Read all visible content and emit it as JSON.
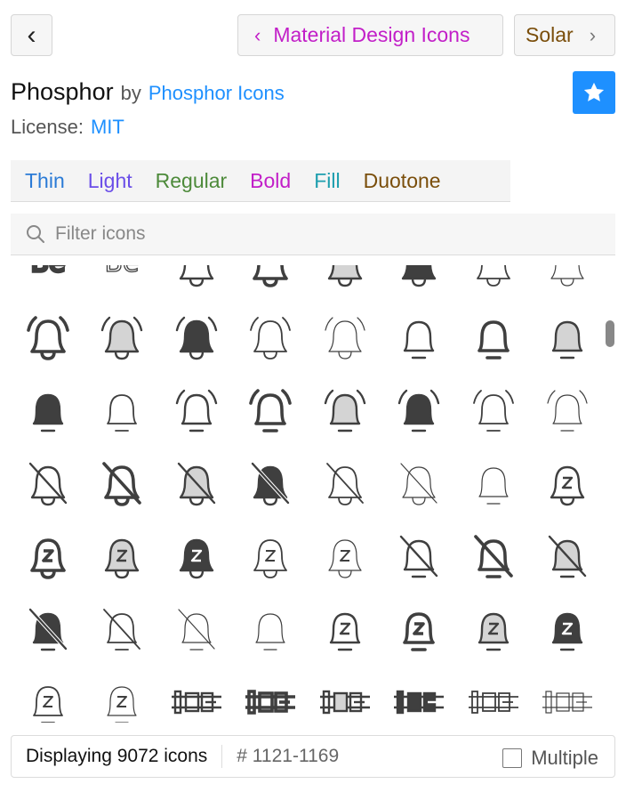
{
  "nav": {
    "back_label": "‹",
    "prev_label": "Material Design Icons",
    "prev_color": "#c21fc8",
    "next_label": "Solar",
    "next_color": "#7a4e0b"
  },
  "header": {
    "set_name": "Phosphor",
    "by": "by",
    "author": "Phosphor Icons",
    "license_label": "License:",
    "license_value": "MIT",
    "favorite_icon": "star-icon"
  },
  "tabs": [
    {
      "label": "Thin",
      "color": "#2b7bd6"
    },
    {
      "label": "Light",
      "color": "#6a4ee8"
    },
    {
      "label": "Regular",
      "color": "#4d8a3a"
    },
    {
      "label": "Bold",
      "color": "#c21fc8"
    },
    {
      "label": "Fill",
      "color": "#1d9eae"
    },
    {
      "label": "Duotone",
      "color": "#7a4e0b"
    }
  ],
  "search": {
    "placeholder": "Filter icons",
    "value": "",
    "icon": "search-icon"
  },
  "grid": {
    "icon_color": "#3f3f3f",
    "duotone_color": "#d4d4d4",
    "rows": [
      [
        "text-b-bold",
        "text-b-thin",
        "bell-regular",
        "bell-bold",
        "bell-duotone",
        "bell-fill",
        "bell-light",
        "bell-thin"
      ],
      [
        "bell-ringing-bold",
        "bell-ringing-duotone",
        "bell-ringing-fill",
        "bell-ringing-light",
        "bell-ringing-thin",
        "bell-simple-regular",
        "bell-simple-bold",
        "bell-simple-duotone"
      ],
      [
        "bell-simple-fill",
        "bell-simple-light",
        "bell-simple-ringing-regular",
        "bell-simple-ringing-bold",
        "bell-simple-ringing-duotone",
        "bell-simple-ringing-fill",
        "bell-simple-ringing-light",
        "bell-simple-ringing-thin"
      ],
      [
        "bell-slash-regular",
        "bell-slash-bold",
        "bell-slash-duotone",
        "bell-slash-fill",
        "bell-slash-light",
        "bell-slash-thin",
        "bell-simple-thin",
        "bell-z-regular"
      ],
      [
        "bell-z-bold",
        "bell-z-duotone",
        "bell-z-fill",
        "bell-z-light",
        "bell-z-thin",
        "bell-simple-slash-regular",
        "bell-simple-slash-bold",
        "bell-simple-slash-duotone"
      ],
      [
        "bell-simple-slash-fill",
        "bell-simple-slash-light",
        "bell-simple-slash-thin",
        "bell-simple-thin",
        "bell-simple-z-regular",
        "bell-simple-z-bold",
        "bell-simple-z-duotone",
        "bell-simple-z-fill"
      ],
      [
        "bell-simple-z-light",
        "bell-simple-z-thin",
        "belt-regular",
        "belt-bold",
        "belt-duotone",
        "belt-fill",
        "belt-light",
        "belt-thin"
      ]
    ]
  },
  "footer": {
    "count": "Displaying 9072 icons",
    "range": "# 1121-1169",
    "multiple_label": "Multiple",
    "multiple_checked": false
  }
}
